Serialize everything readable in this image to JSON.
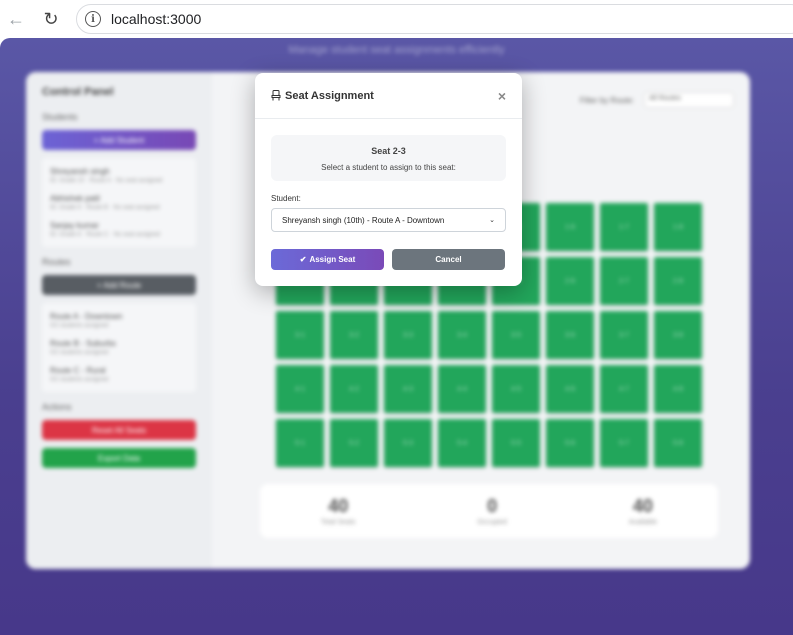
{
  "browser": {
    "url": "localhost:3000",
    "back_icon": "arrow-left-icon",
    "reload_icon": "reload-icon",
    "info_icon": "info-icon"
  },
  "app": {
    "subtitle": "Manage student seat assignments efficiently",
    "sidebar": {
      "title": "Control Panel",
      "students_section": "Students",
      "add_student": "+ Add Student",
      "students": [
        {
          "name": "Shreyansh singh",
          "detail": "ID: Grade 10 · Route A · No seat assigned"
        },
        {
          "name": "Abhishek patil",
          "detail": "ID: Grade 9 · Route B · No seat assigned"
        },
        {
          "name": "Sanjay kumar",
          "detail": "ID: Grade 8 · Route C · No seat assigned"
        }
      ],
      "routes_section": "Routes",
      "add_route": "+ Add Route",
      "routes": [
        {
          "name": "Route A - Downtown",
          "detail": "0/2 students assigned"
        },
        {
          "name": "Route B - Suburbs",
          "detail": "0/2 students assigned"
        },
        {
          "name": "Route C - Rural",
          "detail": "0/2 students assigned"
        }
      ],
      "actions_section": "Actions",
      "reset_all": "Reset All Seats",
      "export_data": "Export Data"
    },
    "main": {
      "filter_label": "Filter by Route:",
      "filter_value": "All Routes",
      "seats": [
        "1-1",
        "1-2",
        "1-3",
        "1-4",
        "1-5",
        "1-6",
        "1-7",
        "1-8",
        "2-1",
        "2-2",
        "2-3",
        "2-4",
        "2-5",
        "2-6",
        "2-7",
        "2-8",
        "3-1",
        "3-2",
        "3-3",
        "3-4",
        "3-5",
        "3-6",
        "3-7",
        "3-8",
        "4-1",
        "4-2",
        "4-3",
        "4-4",
        "4-5",
        "4-6",
        "4-7",
        "4-8",
        "5-1",
        "5-2",
        "5-3",
        "5-4",
        "5-5",
        "5-6",
        "5-7",
        "5-8"
      ],
      "stats": [
        {
          "value": "40",
          "label": "Total Seats"
        },
        {
          "value": "0",
          "label": "Occupied"
        },
        {
          "value": "40",
          "label": "Available"
        }
      ]
    }
  },
  "modal": {
    "title": "Seat Assignment",
    "close": "×",
    "seat_label": "Seat 2-3",
    "prompt": "Select a student to assign to this seat:",
    "student_label": "Student:",
    "student_selected": "Shreyansh singh (10th) - Route A - Downtown",
    "assign_button": "Assign Seat",
    "cancel_button": "Cancel"
  }
}
